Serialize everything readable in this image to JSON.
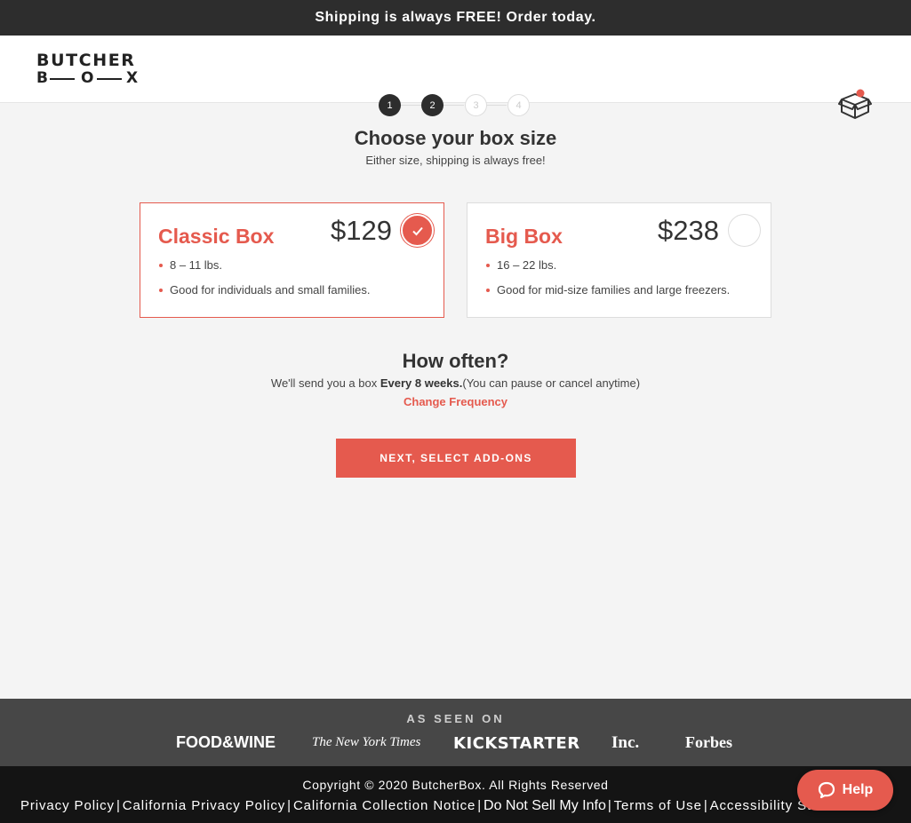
{
  "topbar": {
    "text": "Shipping is always FREE! Order today."
  },
  "header": {
    "logo_top": "BUTCHER",
    "logo_b": "B",
    "logo_o": "O",
    "logo_x": "X",
    "steps": [
      "1",
      "2",
      "3",
      "4"
    ],
    "current_step": 2,
    "cart_icon": "box-icon"
  },
  "main": {
    "title": "Choose your box size",
    "subtitle": "Either size, shipping is always free!"
  },
  "boxes": [
    {
      "name": "Classic Box",
      "price": "$129",
      "selected": true,
      "bullets": [
        "8 – 11 lbs.",
        "Good for individuals and small families."
      ]
    },
    {
      "name": "Big Box",
      "price": "$238",
      "selected": false,
      "bullets": [
        "16 – 22 lbs.",
        "Good for mid-size families and large freezers."
      ]
    }
  ],
  "frequency": {
    "title": "How often?",
    "text_before": "We'll send you a box ",
    "interval": "Every 8 weeks.",
    "text_after": "(You can pause or cancel anytime)",
    "change_link": "Change Frequency"
  },
  "next_button": "NEXT, SELECT ADD-ONS",
  "press": {
    "label": "AS SEEN ON",
    "logos": [
      "FOOD&WINE",
      "The New York Times",
      "KICKSTARTER",
      "Inc.",
      "Forbes"
    ]
  },
  "footer": {
    "copyright": "Copyright © 2020 ButcherBox. All Rights Reserved",
    "links": [
      "Privacy Policy",
      "California Privacy Policy",
      "California Collection Notice",
      "Do Not Sell My Info",
      "Terms of Use",
      "Accessibility Statement"
    ]
  },
  "help": {
    "label": "Help"
  },
  "colors": {
    "accent": "#e55a4e",
    "dark": "#2d2d2d",
    "press_bg": "#474747",
    "footer_bg": "#141414"
  }
}
